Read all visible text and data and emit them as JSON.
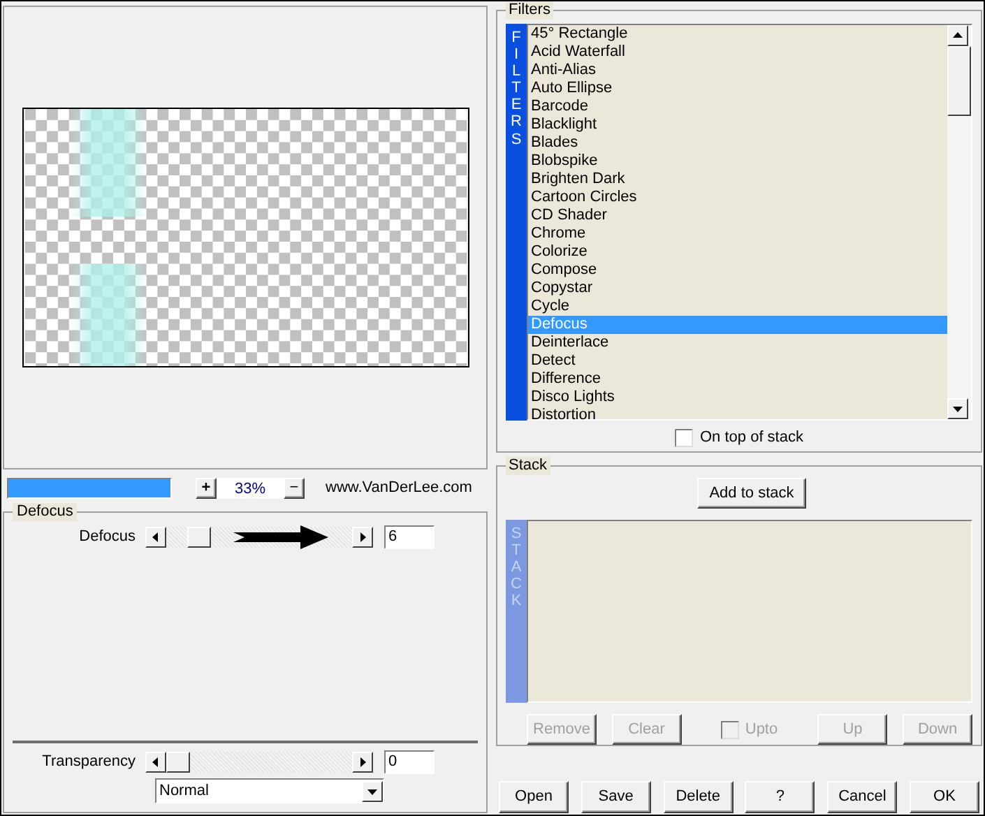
{
  "preview": {
    "zoom_in": "+",
    "zoom": "33%",
    "zoom_out": "−",
    "progress": {
      "level": 1
    },
    "link": "www.VanDerLee.com"
  },
  "effect_group": {
    "title": "Defocus",
    "sliders": [
      {
        "label": "Defocus",
        "value": "6",
        "level": 0.13
      }
    ]
  },
  "transparency": {
    "label": "Transparency",
    "value": "0",
    "level": 0,
    "blend_mode": "Normal"
  },
  "filters": {
    "title": "Filters",
    "sidebar": "FILTERS",
    "items": [
      {
        "label": "45° Rectangle",
        "selected": false
      },
      {
        "label": "Acid Waterfall",
        "selected": false
      },
      {
        "label": "Anti-Alias",
        "selected": false
      },
      {
        "label": "Auto Ellipse",
        "selected": false
      },
      {
        "label": "Barcode",
        "selected": false
      },
      {
        "label": "Blacklight",
        "selected": false
      },
      {
        "label": "Blades",
        "selected": false
      },
      {
        "label": "Blobspike",
        "selected": false
      },
      {
        "label": "Brighten Dark",
        "selected": false
      },
      {
        "label": "Cartoon Circles",
        "selected": false
      },
      {
        "label": "CD Shader",
        "selected": false
      },
      {
        "label": "Chrome",
        "selected": false
      },
      {
        "label": "Colorize",
        "selected": false
      },
      {
        "label": "Compose",
        "selected": false
      },
      {
        "label": "Copystar",
        "selected": false
      },
      {
        "label": "Cycle",
        "selected": false
      },
      {
        "label": "Defocus",
        "selected": true
      },
      {
        "label": "Deinterlace",
        "selected": false
      },
      {
        "label": "Detect",
        "selected": false
      },
      {
        "label": "Difference",
        "selected": false
      },
      {
        "label": "Disco Lights",
        "selected": false
      },
      {
        "label": "Distortion",
        "selected": false
      }
    ],
    "on_top": {
      "label": "On top of stack",
      "checked": false
    }
  },
  "stack": {
    "title": "Stack",
    "add_button": "Add to stack",
    "sidebar": "STACK",
    "controls": [
      {
        "kind": "button",
        "label": "Remove",
        "disabled": true
      },
      {
        "kind": "button",
        "label": "Clear",
        "disabled": true
      },
      {
        "kind": "checkbox",
        "label": "Upto",
        "checked": false,
        "disabled": true
      },
      {
        "kind": "button",
        "label": "Up",
        "disabled": true
      },
      {
        "kind": "button",
        "label": "Down",
        "disabled": true
      }
    ]
  },
  "buttons": [
    "Open",
    "Save",
    "Delete",
    "?",
    "Cancel",
    "OK"
  ]
}
